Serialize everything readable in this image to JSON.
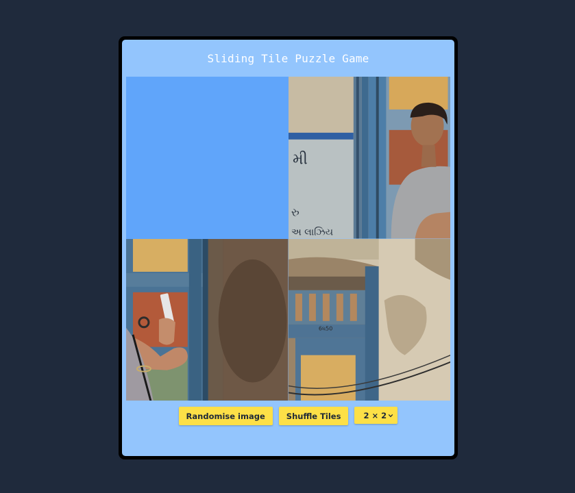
{
  "game": {
    "title": "Sliding Tile Puzzle Game",
    "grid_size": 2,
    "tiles": [
      {
        "label": "empty",
        "kind": "empty"
      },
      {
        "label": "man-in-grey-tshirt-by-blue-door",
        "kind": "image"
      },
      {
        "label": "hand-holding-phone-by-door",
        "kind": "image"
      },
      {
        "label": "weathered-wall-with-doorway",
        "kind": "image"
      }
    ]
  },
  "controls": {
    "randomise_label": "Randomise image",
    "shuffle_label": "Shuffle Tiles",
    "size_select_value": "2 × 2"
  },
  "colors": {
    "page_bg": "#1f2a3c",
    "panel_bg": "#93c5fd",
    "empty_tile": "#60a5fa",
    "button_bg": "#fde047"
  },
  "icons": {
    "select_arrow": "chevron-down-icon"
  }
}
